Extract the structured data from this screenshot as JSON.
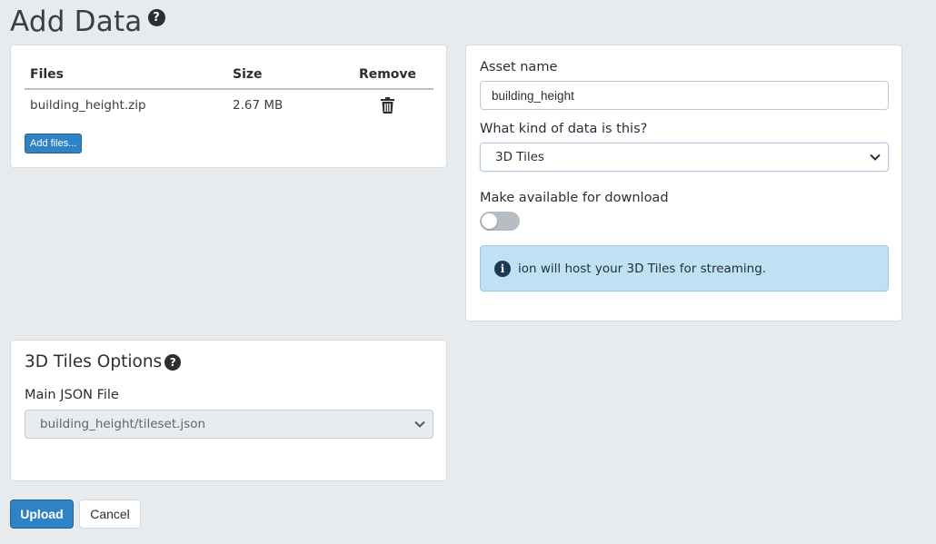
{
  "page": {
    "title": "Add Data",
    "help_glyph": "?"
  },
  "files_table": {
    "headers": {
      "files": "Files",
      "size": "Size",
      "remove": "Remove"
    },
    "rows": [
      {
        "name": "building_height.zip",
        "size": "2.67 MB",
        "remove_icon": "trash-icon"
      }
    ],
    "add_files_label": "Add files..."
  },
  "asset": {
    "name_label": "Asset name",
    "name_value": "building_height",
    "kind_label": "What kind of data is this?",
    "kind_value": "3D Tiles",
    "download_label": "Make available for download",
    "download_enabled": false,
    "info_text": "ion will host your 3D Tiles for streaming."
  },
  "tiles_options": {
    "title": "3D Tiles Options",
    "main_json_label": "Main JSON File",
    "main_json_value": "building_height/tileset.json"
  },
  "actions": {
    "upload_label": "Upload",
    "cancel_label": "Cancel"
  },
  "colors": {
    "primary": "#2f82c4",
    "background": "#e8ebed",
    "info_bg": "#bfe1f4",
    "toggle_off": "#b6bdc4"
  }
}
